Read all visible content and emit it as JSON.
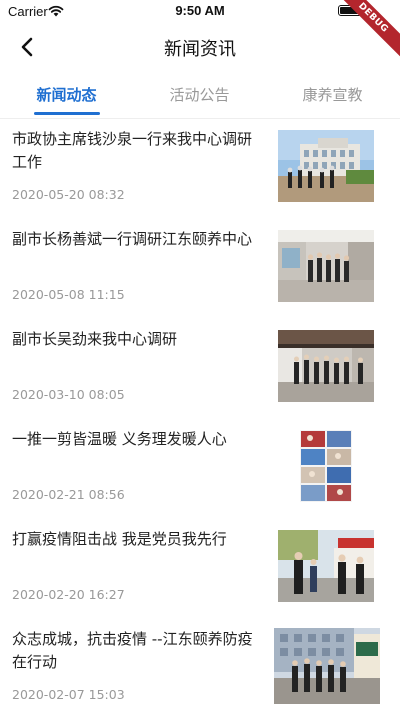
{
  "status_bar": {
    "carrier": "Carrier",
    "time": "9:50 AM"
  },
  "debug_banner": "DEBUG",
  "nav": {
    "title": "新闻资讯"
  },
  "tabs": [
    {
      "label": "新闻动态",
      "active": true
    },
    {
      "label": "活动公告",
      "active": false
    },
    {
      "label": "康养宣教",
      "active": false
    }
  ],
  "news": [
    {
      "title": "市政协主席钱沙泉一行来我中心调研工作",
      "date": "2020-05-20 08:32"
    },
    {
      "title": "副市长杨善斌一行调研江东颐养中心",
      "date": "2020-05-08 11:15"
    },
    {
      "title": "副市长吴劲来我中心调研",
      "date": "2020-03-10 08:05"
    },
    {
      "title": "一推一剪皆温暖  义务理发暖人心",
      "date": "2020-02-21 08:56"
    },
    {
      "title": "打赢疫情阻击战  我是党员我先行",
      "date": "2020-02-20 16:27"
    },
    {
      "title": "众志成城，抗击疫情  --江东颐养防疫在行动",
      "date": "2020-02-07 15:03"
    }
  ],
  "colors": {
    "accent": "#1f6fd1",
    "debug": "#b3262d"
  }
}
